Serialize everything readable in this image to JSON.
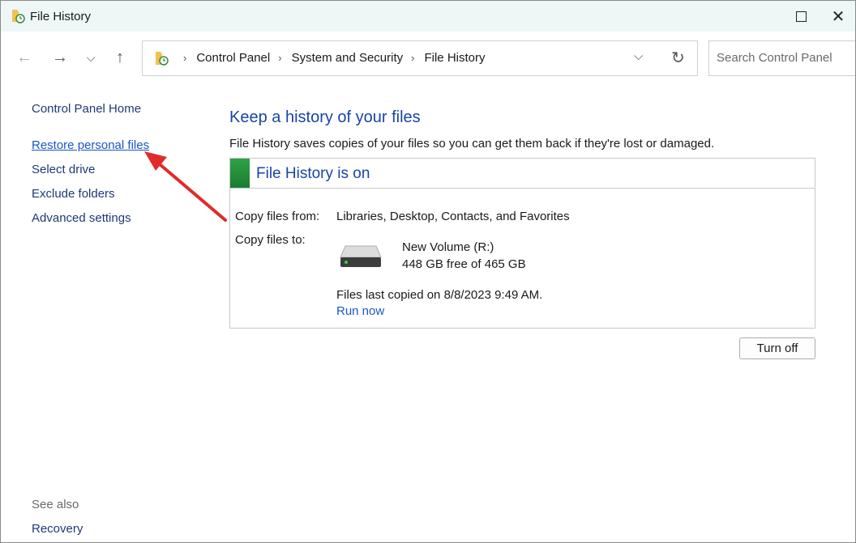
{
  "window": {
    "title": "File History"
  },
  "nav": {
    "breadcrumbs": [
      "Control Panel",
      "System and Security",
      "File History"
    ],
    "search_placeholder": "Search Control Panel"
  },
  "sidebar": {
    "home": "Control Panel Home",
    "restore": "Restore personal files",
    "select_drive": "Select drive",
    "exclude": "Exclude folders",
    "advanced": "Advanced settings",
    "see_also": "See also",
    "recovery": "Recovery"
  },
  "main": {
    "heading": "Keep a history of your files",
    "description": "File History saves copies of your files so you can get them back if they're lost or damaged.",
    "status_title": "File History is on",
    "status_color": "#2fa24a",
    "copy_from_label": "Copy files from:",
    "copy_from_value": "Libraries, Desktop, Contacts, and Favorites",
    "copy_to_label": "Copy files to:",
    "drive_name": "New Volume (R:)",
    "drive_space": "448 GB free of 465 GB",
    "last_copied": "Files last copied on 8/8/2023 9:49 AM.",
    "run_now": "Run now",
    "turn_off": "Turn off"
  },
  "annotation": {
    "arrow_color": "#e02b2b",
    "target": "Restore personal files"
  }
}
